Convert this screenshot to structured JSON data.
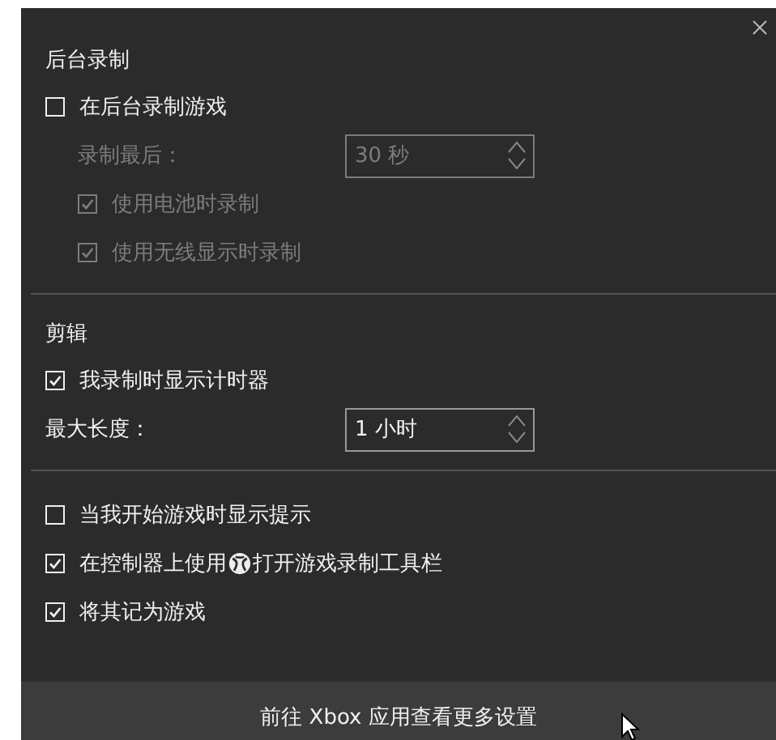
{
  "sections": [
    {
      "title": "后台录制",
      "items": [
        {
          "kind": "checkbox",
          "label": "在后台录制游戏",
          "checked": false,
          "disabled": false,
          "children": [
            {
              "kind": "spinner",
              "label": "录制最后：",
              "value": "30 秒",
              "disabled": true
            },
            {
              "kind": "checkbox",
              "label": "使用电池时录制",
              "checked": true,
              "disabled": true
            },
            {
              "kind": "checkbox",
              "label": "使用无线显示时录制",
              "checked": true,
              "disabled": true
            }
          ]
        }
      ]
    },
    {
      "title": "剪辑",
      "items": [
        {
          "kind": "checkbox",
          "label": "我录制时显示计时器",
          "checked": true,
          "disabled": false
        },
        {
          "kind": "spinner",
          "label": "最大长度：",
          "value": "1 小时",
          "disabled": false
        }
      ]
    },
    {
      "items": [
        {
          "kind": "checkbox",
          "label": "当我开始游戏时显示提示",
          "checked": false,
          "disabled": false
        },
        {
          "kind": "checkbox",
          "label": "在控制器上使用",
          "label_after": "打开游戏录制工具栏",
          "checked": true,
          "disabled": false
        },
        {
          "kind": "checkbox",
          "label": "将其记为游戏",
          "checked": true,
          "disabled": false
        }
      ]
    }
  ],
  "footer": {
    "link": "前往 Xbox 应用查看更多设置"
  }
}
